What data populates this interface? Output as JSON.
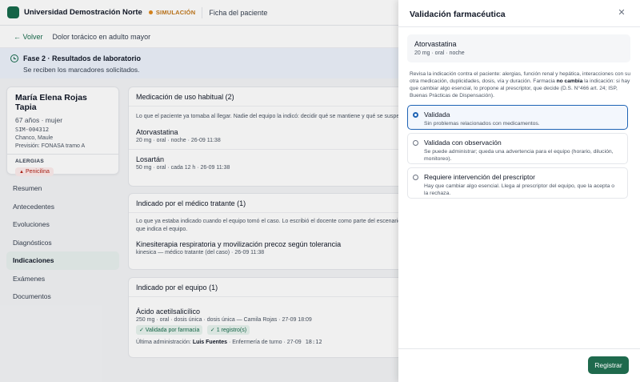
{
  "topbar": {
    "university": "Universidad Demostración Norte",
    "mode": "SIMULACIÓN",
    "page": "Ficha del paciente"
  },
  "subbar": {
    "back": "← Volver",
    "case": "Dolor torácico en adulto mayor"
  },
  "phase": {
    "title": "Fase 2 · Resultados de laboratorio",
    "subtitle": "Se reciben los marcadores solicitados."
  },
  "patient": {
    "name": "María Elena Rojas Tapia",
    "age_sex": "67 años · mujer",
    "id": "SIM-004312",
    "location": "Chanco, Maule",
    "insurance": "Previsión: FONASA tramo A",
    "allergies_label": "ALERGIAS",
    "allergy": "Penicilina"
  },
  "nav": {
    "items": [
      "Resumen",
      "Antecedentes",
      "Evoluciones",
      "Diagnósticos",
      "Indicaciones",
      "Exámenes",
      "Documentos"
    ],
    "active": "Indicaciones"
  },
  "sections": {
    "habitual": {
      "title": "Medicación de uso habitual (2)",
      "desc": "Lo que el paciente ya tomaba al llegar. Nadie del equipo la indicó: decidir qué se mantiene y qué se suspende.",
      "items": [
        {
          "name": "Atorvastatina",
          "meta": "20 mg · oral · noche · 26-09 11:38"
        },
        {
          "name": "Losartán",
          "meta": "50 mg · oral · cada 12 h · 26-09 11:38"
        }
      ]
    },
    "tratante": {
      "title": "Indicado por el médico tratante (1)",
      "desc1": "Lo que ya estaba indicado cuando el equipo tomó el caso. Lo escribió el docente como parte del escenario,",
      "desc2": "que indica el equipo.",
      "item_name": "Kinesiterapia respiratoria y movilización precoz según tolerancia",
      "item_meta": "kinesica — médico tratante (del caso) · 26-09 11:38"
    },
    "equipo": {
      "title": "Indicado por el equipo (1)",
      "item_name": "Ácido acetilsalicílico",
      "item_meta": "250 mg · oral · dosis única · dosis única — Camila Rojas · 27-09 18:09",
      "badge1": "✓ Validada por farmacia",
      "badge2": "✓ 1 registro(s)",
      "last_admin_label": "Última administración:",
      "last_admin_name": "Luis Fuentes",
      "last_admin_rest": "· Enfermería de turno · 27-09",
      "last_admin_time": "18:12"
    }
  },
  "drawer": {
    "title": "Validación farmacéutica",
    "close_icon": "close-icon",
    "med_name": "Atorvastatina",
    "med_meta": "20 mg · oral · noche",
    "desc_part1": "Revisa la indicación contra el paciente: alergias, función renal y hepática, interacciones con su otra medicación, duplicidades, dosis, vía y duración. Farmacia",
    "desc_bold": "no cambia",
    "desc_part2": "la indicación: si hay que cambiar algo esencial, lo propone al prescriptor, que decide (D.S. N°466 art. 24; ISP, Buenas Prácticas de Dispensación).",
    "options": [
      {
        "title": "Validada",
        "desc": "Sin problemas relacionados con medicamentos."
      },
      {
        "title": "Validada con observación",
        "desc": "Se puede administrar; queda una advertencia para el equipo (horario, dilución, monitoreo)."
      },
      {
        "title": "Requiere intervención del prescriptor",
        "desc": "Hay que cambiar algo esencial. Llega al prescriptor del equipo, que la acepta o la rechaza."
      }
    ],
    "selected": "Validada",
    "submit": "Registrar"
  },
  "colors": {
    "brand": "#176b4c",
    "simulation": "#c2771a",
    "allergy": "#b42318",
    "selection": "#1e63b5"
  }
}
